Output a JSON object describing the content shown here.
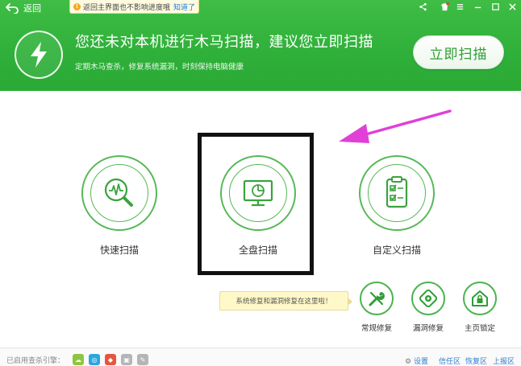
{
  "topbar": {
    "back_label": "返回",
    "notice_text": "返回主界面也不影响进度哦",
    "notice_action": "知道了"
  },
  "hero": {
    "title": "您还未对本机进行木马扫描，建议您立即扫描",
    "subtitle": "定期木马查杀，修复系统漏洞，时刻保持电脑健康",
    "scan_now_label": "立即扫描"
  },
  "scan_options": [
    {
      "label": "快速扫描",
      "icon": "magnifier-pulse-icon"
    },
    {
      "label": "全盘扫描",
      "icon": "monitor-icon"
    },
    {
      "label": "自定义扫描",
      "icon": "checklist-icon"
    }
  ],
  "tip": {
    "text": "系统修复和漏洞修复在这里啦！"
  },
  "tools": [
    {
      "label": "常规修复",
      "icon": "wrench-icon"
    },
    {
      "label": "漏洞修复",
      "icon": "shield-patch-icon"
    },
    {
      "label": "主页锁定",
      "icon": "home-lock-icon"
    }
  ],
  "footer": {
    "engines_label": "已启用查杀引擎：",
    "settings": "设置",
    "trust_zone": "信任区",
    "restore_zone": "恢复区",
    "report_zone": "上报区"
  },
  "colors": {
    "brand_green": "#2fb03a",
    "highlight_arrow": "#e040d8",
    "link_blue": "#2f7fd0"
  }
}
